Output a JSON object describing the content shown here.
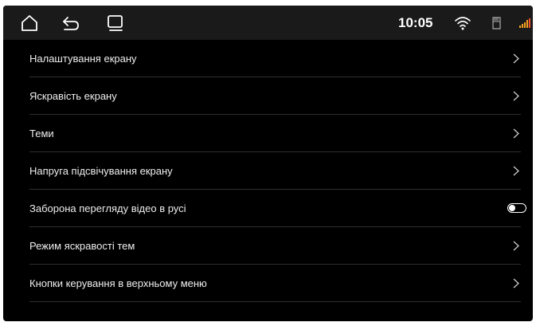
{
  "status_bar": {
    "time": "10:05",
    "icons": {
      "home": "home-icon",
      "back": "back-icon",
      "recents": "recent-apps-icon",
      "wifi": "wifi-icon",
      "sd_card": "sd-card-icon",
      "signal": "signal-icon"
    },
    "signal_color": "#f0a020"
  },
  "settings": {
    "items": [
      {
        "label": "Налаштування екрану",
        "control": "chevron"
      },
      {
        "label": "Яскравість екрану",
        "control": "chevron"
      },
      {
        "label": "Теми",
        "control": "chevron"
      },
      {
        "label": "Напруга підсвічування екрану",
        "control": "chevron"
      },
      {
        "label": "Заборона перегляду відео в русі",
        "control": "toggle",
        "toggle_on": false
      },
      {
        "label": "Режим яскравості тем",
        "control": "chevron"
      },
      {
        "label": "Кнопки керування в верхньому меню",
        "control": "chevron"
      }
    ]
  },
  "colors": {
    "background": "#000000",
    "status_bar": "#1a1a1a",
    "text": "#eeeeee",
    "divider": "#2f2f2f"
  }
}
